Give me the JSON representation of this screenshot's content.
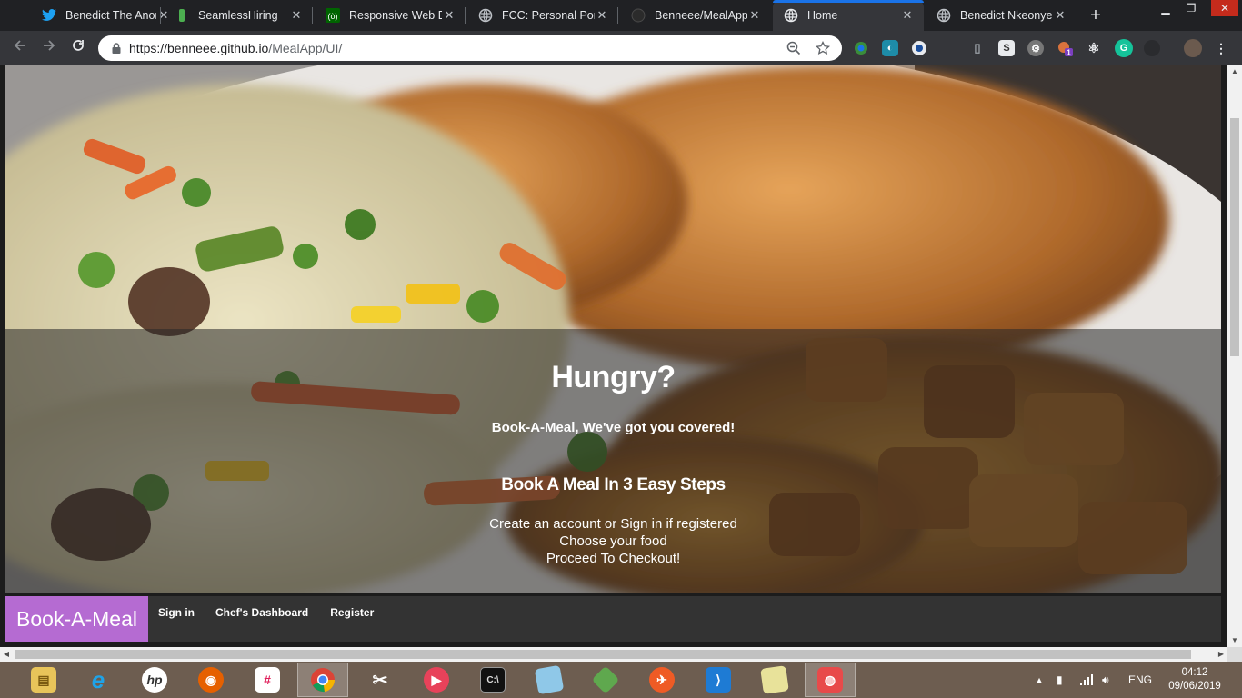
{
  "browser": {
    "tabs": [
      {
        "title": "Benedict The Anom",
        "icon": "twitter-icon",
        "color": "#1da1f2",
        "active": false
      },
      {
        "title": "SeamlessHiring",
        "icon": "seamlesshiring-icon",
        "color": "#4caf50",
        "active": false
      },
      {
        "title": "Responsive Web De",
        "icon": "freecodecamp-icon",
        "color": "#006400",
        "active": false
      },
      {
        "title": "FCC: Personal Portf",
        "icon": "globe-icon",
        "color": "#9aa0a6",
        "active": false
      },
      {
        "title": "Benneee/MealApp:",
        "icon": "github-icon",
        "color": "#3c3c3c",
        "active": false
      },
      {
        "title": "Home",
        "icon": "globe-icon",
        "color": "#9aa0a6",
        "active": true
      },
      {
        "title": "Benedict Nkeonye",
        "icon": "globe-icon",
        "color": "#9aa0a6",
        "active": false
      }
    ],
    "new_tab_label": "+",
    "window_controls": {
      "minimize": "▁",
      "restore": "❐",
      "close": "✕"
    },
    "url": {
      "host": "https://benneee.github.io",
      "path": "/MealApp/UI/"
    },
    "extensions": [
      "extension-icon-1",
      "extension-icon-2",
      "extension-icon-3",
      "extension-icon-4",
      "extension-icon-5",
      "extension-icon-6",
      "extension-icon-7",
      "extension-icon-8",
      "grammarly-icon"
    ],
    "extension_badge": "1"
  },
  "page": {
    "hero": {
      "title": "Hungry?",
      "tagline": "Book-A-Meal, We've got you covered!",
      "steps_heading": "Book A Meal In 3 Easy Steps",
      "steps": [
        "Create an account or Sign in if registered",
        "Choose your food",
        "Proceed To Checkout!"
      ]
    },
    "navbar": {
      "brand": "Book-A-Meal",
      "brand_color": "#b56bd2",
      "links": [
        "Sign in",
        "Chef's Dashboard",
        "Register"
      ]
    }
  },
  "taskbar": {
    "apps": [
      "file-explorer-icon",
      "internet-explorer-icon",
      "hp-icon",
      "firefox-icon",
      "slack-icon",
      "chrome-icon",
      "paint-icon",
      "media-player-icon",
      "terminal-icon",
      "notepad-icon",
      "git-icon",
      "postman-icon",
      "vscode-icon",
      "sticky-notes-icon",
      "camera-icon"
    ],
    "language": "ENG",
    "time": "04:12",
    "date": "09/06/2019"
  }
}
